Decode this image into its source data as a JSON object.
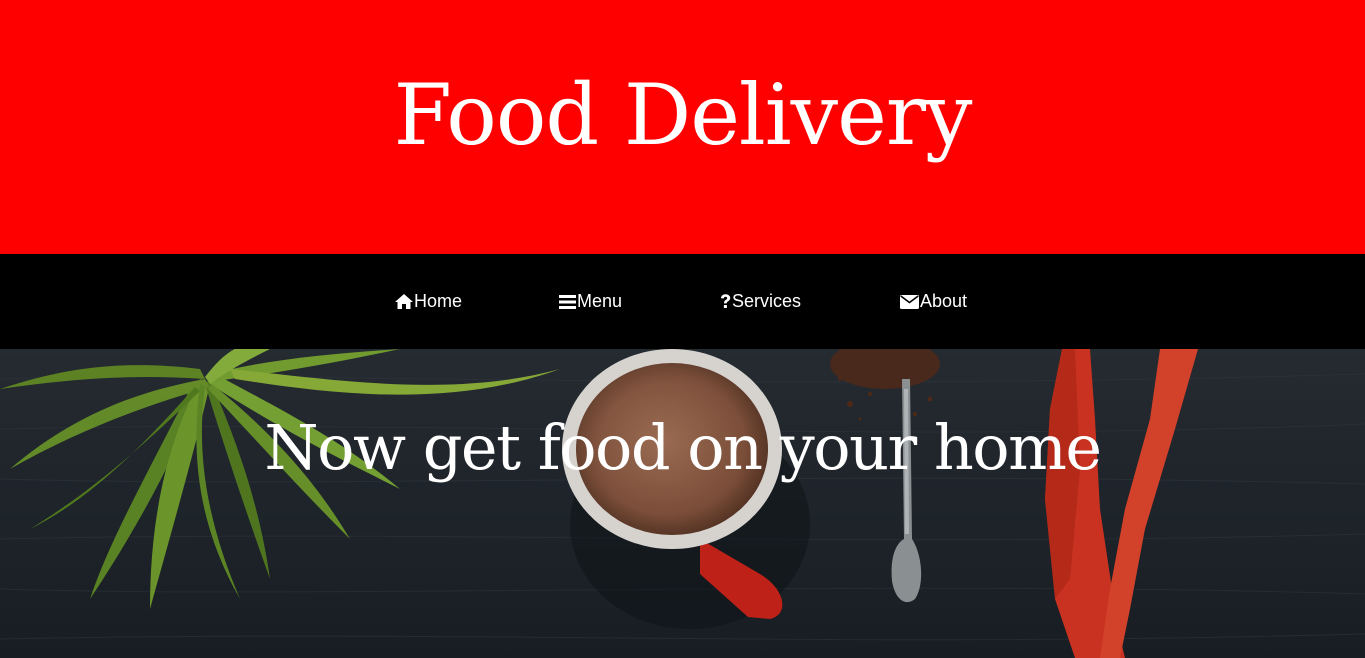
{
  "header": {
    "title": "Food Delivery",
    "background_color": "#ff0000"
  },
  "nav": {
    "items": [
      {
        "label": "Home",
        "icon": "home-icon"
      },
      {
        "label": "Menu",
        "icon": "bars-icon"
      },
      {
        "label": "Services",
        "icon": "question-icon"
      },
      {
        "label": "About",
        "icon": "envelope-icon"
      }
    ]
  },
  "hero": {
    "heading": "Now get food on your home"
  }
}
